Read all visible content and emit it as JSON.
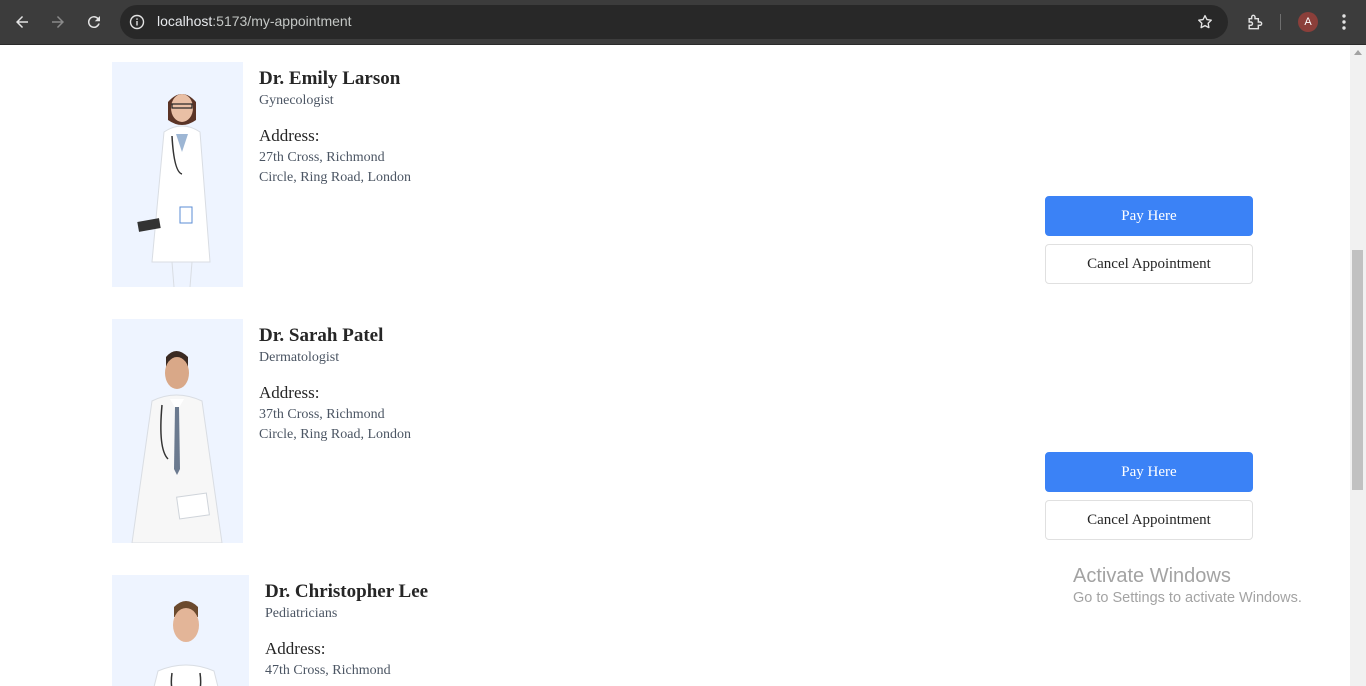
{
  "browser": {
    "url_host": "localhost",
    "url_path": ":5173/my-appointment",
    "avatar_letter": "A"
  },
  "appointments": [
    {
      "name": "Dr. Emily Larson",
      "speciality": "Gynecologist",
      "address_label": "Address:",
      "address_line1": "27th Cross, Richmond",
      "address_line2": "Circle, Ring Road, London",
      "pay_label": "Pay Here",
      "cancel_label": "Cancel Appointment"
    },
    {
      "name": "Dr. Sarah Patel",
      "speciality": "Dermatologist",
      "address_label": "Address:",
      "address_line1": "37th Cross, Richmond",
      "address_line2": "Circle, Ring Road, London",
      "pay_label": "Pay Here",
      "cancel_label": "Cancel Appointment"
    },
    {
      "name": "Dr. Christopher Lee",
      "speciality": "Pediatricians",
      "address_label": "Address:",
      "address_line1": "47th Cross, Richmond"
    }
  ],
  "watermark": {
    "title": "Activate Windows",
    "subtitle": "Go to Settings to activate Windows."
  },
  "colors": {
    "primary": "#3b82f6",
    "photo_bg": "#eef4ff",
    "chrome_bg": "#3c3c3c"
  }
}
